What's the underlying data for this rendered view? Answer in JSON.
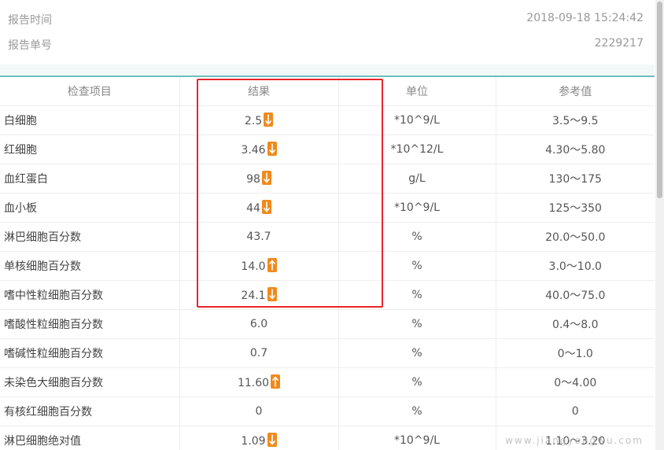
{
  "header": {
    "report_time_label": "报告时间",
    "report_time_value": "2018-09-18 15:24:42",
    "report_no_label": "报告单号",
    "report_no_value": "2229217"
  },
  "table": {
    "columns": [
      "检查项目",
      "结果",
      "单位",
      "参考值"
    ],
    "rows": [
      {
        "name": "白细胞",
        "result": "2.5",
        "flag": "down",
        "unit": "*10^9/L",
        "ref": "3.5～9.5"
      },
      {
        "name": "红细胞",
        "result": "3.46",
        "flag": "down",
        "unit": "*10^12/L",
        "ref": "4.30～5.80"
      },
      {
        "name": "血红蛋白",
        "result": "98",
        "flag": "down",
        "unit": "g/L",
        "ref": "130～175"
      },
      {
        "name": "血小板",
        "result": "44",
        "flag": "down",
        "unit": "*10^9/L",
        "ref": "125～350"
      },
      {
        "name": "淋巴细胞百分数",
        "result": "43.7",
        "flag": "",
        "unit": "%",
        "ref": "20.0～50.0"
      },
      {
        "name": "单核细胞百分数",
        "result": "14.0",
        "flag": "up",
        "unit": "%",
        "ref": "3.0～10.0"
      },
      {
        "name": "嗜中性粒细胞百分数",
        "result": "24.1",
        "flag": "down",
        "unit": "%",
        "ref": "40.0～75.0"
      },
      {
        "name": "嗜酸性粒细胞百分数",
        "result": "6.0",
        "flag": "",
        "unit": "%",
        "ref": "0.4～8.0"
      },
      {
        "name": "嗜碱性粒细胞百分数",
        "result": "0.7",
        "flag": "",
        "unit": "%",
        "ref": "0～1.0"
      },
      {
        "name": "未染色大细胞百分数",
        "result": "11.60",
        "flag": "up",
        "unit": "%",
        "ref": "0～4.00"
      },
      {
        "name": "有核红细胞百分数",
        "result": "0",
        "flag": "",
        "unit": "%",
        "ref": "0"
      },
      {
        "name": "淋巴细胞绝对值",
        "result": "1.09",
        "flag": "down",
        "unit": "*10^9/L",
        "ref": "1.10～3.20"
      }
    ]
  },
  "colors": {
    "flag": "#f08a1c",
    "highlight": "#e8262d",
    "teal_line": "#6bbfbf"
  },
  "icons": {
    "down": "arrow-down-icon",
    "up": "arrow-up-icon"
  },
  "watermark": "www.jiangyongwu.com"
}
